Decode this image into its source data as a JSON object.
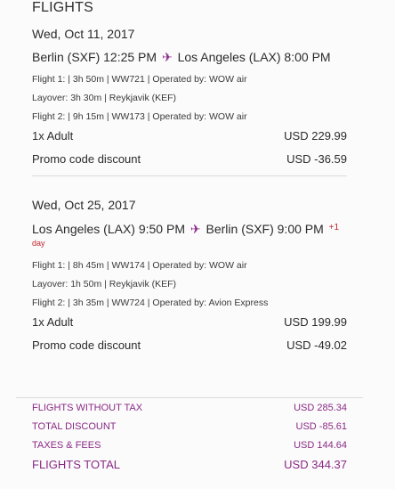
{
  "section_title": "FLIGHTS",
  "legs": [
    {
      "date": "Wed, Oct 11, 2017",
      "from": "Berlin (SXF) 12:25 PM",
      "to": "Los Angeles (LAX) 8:00 PM",
      "details": [
        "Flight 1: | 3h 50m | WW721 | Operated by: WOW air",
        "Layover: 3h 30m | Reykjavik (KEF)",
        "Flight 2: | 9h 15m | WW173 | Operated by: WOW air"
      ],
      "adult_label": "1x Adult",
      "adult_price": "USD 229.99",
      "promo_label": "Promo code discount",
      "promo_value": "USD -36.59"
    },
    {
      "date": "Wed, Oct 25, 2017",
      "from": "Los Angeles (LAX) 9:50 PM",
      "to": "Berlin (SXF) 9:00 PM",
      "plus_day": "+1",
      "day_note": "day",
      "details": [
        "Flight 1: | 8h 45m | WW174 | Operated by: WOW air",
        "Layover: 1h 50m | Reykjavik (KEF)",
        "Flight 2: | 3h 35m | WW724 | Operated by: Avion Express"
      ],
      "adult_label": "1x Adult",
      "adult_price": "USD 199.99",
      "promo_label": "Promo code discount",
      "promo_value": "USD -49.02"
    }
  ],
  "summary": {
    "flights_without_tax_label": "FLIGHTS WITHOUT TAX",
    "flights_without_tax_value": "USD 285.34",
    "total_discount_label": "TOTAL DISCOUNT",
    "total_discount_value": "USD -85.61",
    "taxes_fees_label": "TAXES & FEES",
    "taxes_fees_value": "USD 144.64",
    "flights_total_label": "FLIGHTS TOTAL",
    "flights_total_value": "USD 344.37"
  },
  "colors": {
    "accent": "#8a2a86",
    "plus_day": "#c0262d"
  },
  "icons": {
    "plane": "airplane-icon"
  }
}
